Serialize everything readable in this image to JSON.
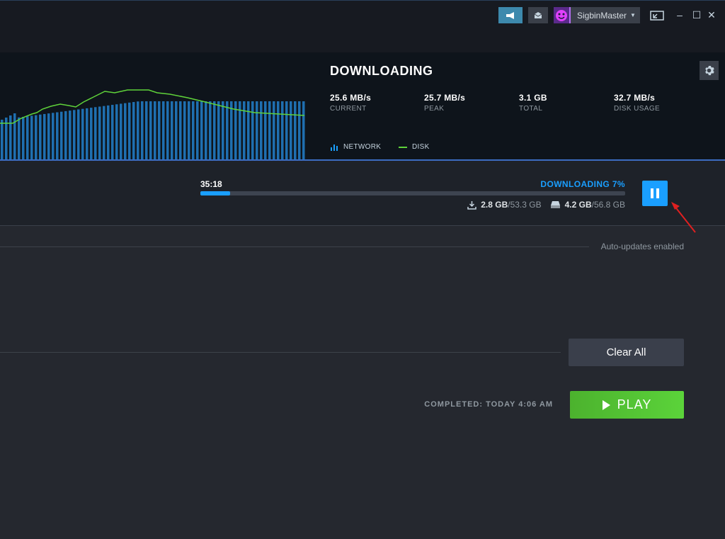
{
  "titlebar": {
    "username": "SigbinMaster",
    "window_controls": [
      "minimize",
      "maximize",
      "close"
    ]
  },
  "download": {
    "title": "DOWNLOADING",
    "stats": [
      {
        "value": "25.6 MB/s",
        "label": "CURRENT"
      },
      {
        "value": "25.7 MB/s",
        "label": "PEAK"
      },
      {
        "value": "3.1 GB",
        "label": "TOTAL"
      },
      {
        "value": "32.7 MB/s",
        "label": "DISK USAGE"
      }
    ],
    "legend": {
      "network": "NETWORK",
      "disk": "DISK"
    },
    "colors": {
      "network_bars": "#1f6fb0",
      "disk_line": "#5fd33a",
      "accent": "#1a9fff"
    }
  },
  "active": {
    "time_left": "35:18",
    "status": "DOWNLOADING 7%",
    "progress": 0.07,
    "downloaded": "2.8 GB",
    "download_total": "/53.3 GB",
    "disk": "4.2 GB",
    "disk_total": "/56.8 GB"
  },
  "queue": {
    "auto_updates": "Auto-updates enabled",
    "clear_all": "Clear All",
    "completed": "COMPLETED: TODAY 4:06 AM",
    "play": "PLAY"
  }
}
